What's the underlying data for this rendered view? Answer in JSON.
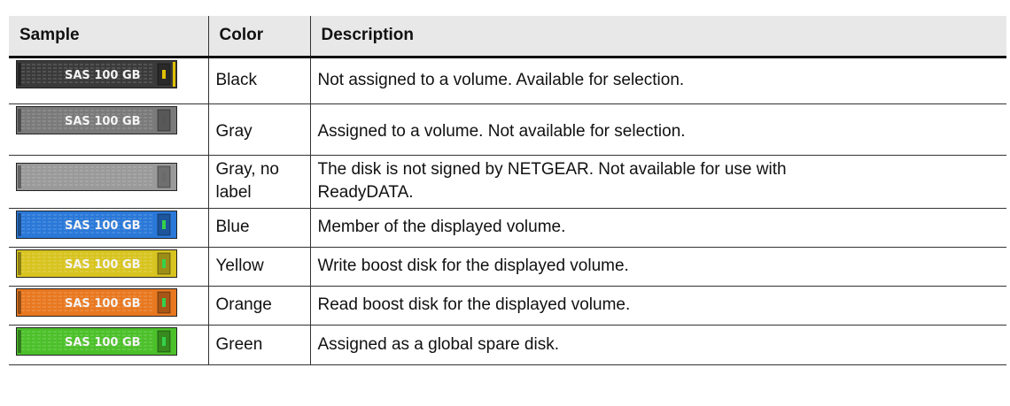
{
  "header": {
    "sample": "Sample",
    "color": "Color",
    "description": "Description"
  },
  "rows": [
    {
      "disk_label": "SAS 100 GB",
      "color": "Black",
      "description": "Not assigned to a volume. Available for selection.",
      "body_color": "#3a3a3a",
      "accent": "#e0c000"
    },
    {
      "disk_label": "SAS 100 GB",
      "color": "Gray",
      "description": "Assigned to a volume. Not available for selection.",
      "body_color": "#7a7a7a",
      "accent": "#555555"
    },
    {
      "disk_label": "",
      "color_line1": "Gray, no",
      "color_line2": "label",
      "description_line1": "The disk is not signed by NETGEAR. Not available for use with",
      "description_line2": "ReadyDATA.",
      "body_color": "#9a9a9a",
      "accent": "#6a6a6a"
    },
    {
      "disk_label": "SAS 100 GB",
      "color": "Blue",
      "description": "Member of the displayed volume.",
      "body_color": "#2a78d8",
      "accent": "#34d24a"
    },
    {
      "disk_label": "SAS 100 GB",
      "color": "Yellow",
      "description": "Write boost disk for the displayed volume.",
      "body_color": "#d8c420",
      "accent": "#34d24a"
    },
    {
      "disk_label": "SAS 100 GB",
      "color": "Orange",
      "description": "Read boost disk for the displayed volume.",
      "body_color": "#e87820",
      "accent": "#34d24a"
    },
    {
      "disk_label": "SAS 100 GB",
      "color": "Green",
      "description": "Assigned as a global spare disk.",
      "body_color": "#4cc02a",
      "accent": "#34d24a"
    }
  ]
}
